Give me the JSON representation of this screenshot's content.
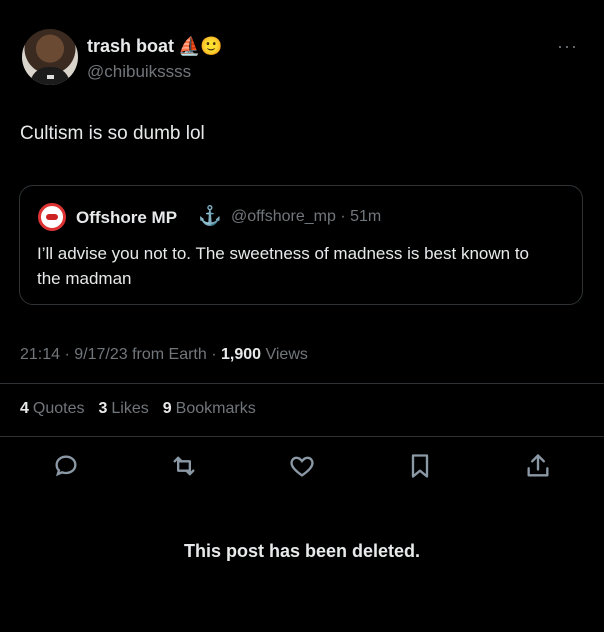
{
  "author": {
    "name": "trash boat",
    "name_emojis": "⛵🙂",
    "handle": "@chibuikssss"
  },
  "more_label": "···",
  "tweet": {
    "text": "Cultism is so dumb lol"
  },
  "quoted": {
    "name": "Offshore MP",
    "anchor": "⚓",
    "handle_time": "@offshore_mp · 51m",
    "text": "I’ll advise you not to. The sweetness of madness is best known to the madman"
  },
  "meta": {
    "time": "21:14 · 9/17/23 from Earth · ",
    "views_count": "1,900",
    "views_label": " Views"
  },
  "stats": [
    {
      "count": "4",
      "label": "Quotes"
    },
    {
      "count": "3",
      "label": "Likes"
    },
    {
      "count": "9",
      "label": "Bookmarks"
    }
  ],
  "deleted_notice": "This post has been deleted.",
  "icons": [
    "reply-icon",
    "repost-icon",
    "like-icon",
    "bookmark-icon",
    "share-icon"
  ]
}
